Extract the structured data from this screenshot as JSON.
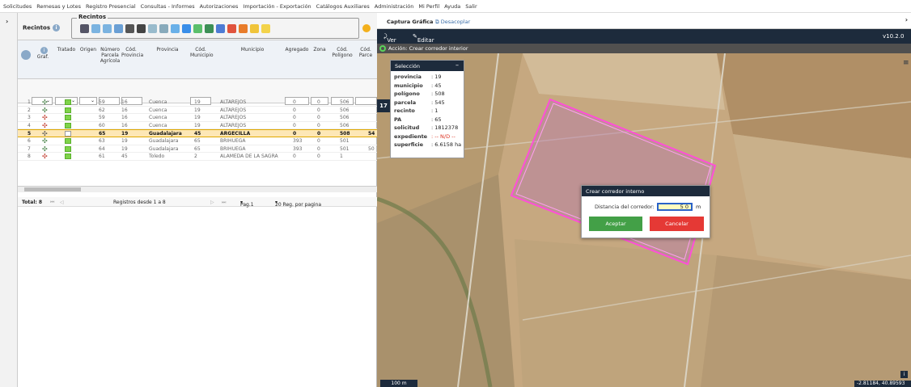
{
  "menu": [
    "Solicitudes",
    "Remesas y Lotes",
    "Registro Presencial",
    "Consultas - Informes",
    "Autorizaciones",
    "Importación - Exportación",
    "Catálogos Auxiliares",
    "Administración",
    "Mi Perfil",
    "Ayuda",
    "Salir"
  ],
  "left": {
    "title": "Recintos",
    "group_label": "Recintos",
    "columns": {
      "graf": "Graf.",
      "tratado": "Tratado",
      "origen": "Origen",
      "numero_parcela": "Número Parcela Agrícola",
      "cod_provincia": "Cód. Provincia",
      "provincia": "Provincia",
      "cod_municipio": "Cód. Municipio",
      "municipio": "Municipio",
      "agregado": "Agregado",
      "zona": "Zona",
      "cod_poligono": "Cód. Polígono",
      "cod_parcela": "Cód. Parce"
    },
    "rows": [
      {
        "n": "1",
        "parcela": "59",
        "cprov": "16",
        "prov": "Cuenca",
        "cmun": "19",
        "mun": "ALTAREJOS",
        "agr": "0",
        "zona": "0",
        "pol": "506",
        "par": ""
      },
      {
        "n": "2",
        "parcela": "62",
        "cprov": "16",
        "prov": "Cuenca",
        "cmun": "19",
        "mun": "ALTAREJOS",
        "agr": "0",
        "zona": "0",
        "pol": "506",
        "par": ""
      },
      {
        "n": "3",
        "parcela": "59",
        "cprov": "16",
        "prov": "Cuenca",
        "cmun": "19",
        "mun": "ALTAREJOS",
        "agr": "0",
        "zona": "0",
        "pol": "506",
        "par": ""
      },
      {
        "n": "4",
        "parcela": "60",
        "cprov": "16",
        "prov": "Cuenca",
        "cmun": "19",
        "mun": "ALTAREJOS",
        "agr": "0",
        "zona": "0",
        "pol": "506",
        "par": ""
      },
      {
        "n": "5",
        "parcela": "65",
        "cprov": "19",
        "prov": "Guadalajara",
        "cmun": "45",
        "mun": "ARGECILLA",
        "agr": "0",
        "zona": "0",
        "pol": "508",
        "par": "54"
      },
      {
        "n": "6",
        "parcela": "63",
        "cprov": "19",
        "prov": "Guadalajara",
        "cmun": "65",
        "mun": "BRIHUEGA",
        "agr": "393",
        "zona": "0",
        "pol": "501",
        "par": ""
      },
      {
        "n": "7",
        "parcela": "64",
        "cprov": "19",
        "prov": "Guadalajara",
        "cmun": "65",
        "mun": "BRIHUEGA",
        "agr": "393",
        "zona": "0",
        "pol": "501",
        "par": "50"
      },
      {
        "n": "8",
        "parcela": "61",
        "cprov": "45",
        "prov": "Toledo",
        "cmun": "2",
        "mun": "ALAMEDA DE LA SAGRA",
        "agr": "0",
        "zona": "0",
        "pol": "1",
        "par": ""
      }
    ],
    "pager": {
      "total": "Total: 8",
      "registros": "Registros desde 1 a 8",
      "page": "Pag.1",
      "per_page": "20 Reg. por pagina"
    }
  },
  "map": {
    "title": "Captura Gráfica",
    "undock": "Desacoplar",
    "ver": "Ver",
    "editar": "Editar",
    "version": "v10.2.0",
    "action": "Acción: Crear corredor interior",
    "side_number": "17",
    "scale": "100 m",
    "coords": "-2.81184, 40.89593",
    "selection": {
      "title": "Selección",
      "fields": [
        {
          "k": "provincia",
          "v": ": 19"
        },
        {
          "k": "municipio",
          "v": ": 45"
        },
        {
          "k": "polígono",
          "v": ": 508"
        },
        {
          "k": "parcela",
          "v": ": 545"
        },
        {
          "k": "recinto",
          "v": ": 1"
        },
        {
          "k": "PA",
          "v": ": 65"
        },
        {
          "k": "solicitud",
          "v": ": 1812378"
        },
        {
          "k": "expediente",
          "v": ": -- N/D --"
        },
        {
          "k": "superficie",
          "v": ": 6.6158 ha"
        }
      ]
    },
    "dialog": {
      "title": "Crear corredor interno",
      "label": "Distancia del corredor:",
      "value": "5 0",
      "unit": "m",
      "ok": "Aceptar",
      "cancel": "Cancelar"
    }
  },
  "colors": {
    "accent_dark": "#1d2b3c",
    "ok": "#43a047",
    "cancel": "#e53935",
    "selected_row": "#fde7b6",
    "parcel_outline": "#ff4fd8"
  }
}
